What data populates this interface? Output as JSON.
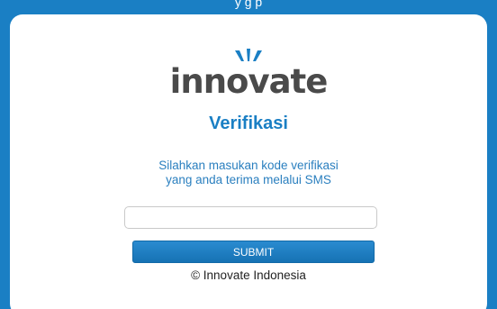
{
  "header": {
    "top_text": "y g p"
  },
  "logo": {
    "text": "innovate",
    "icon": "innovate-sparks-logo",
    "colors": {
      "spark": "#1a7fc4",
      "text": "#4a4a4a"
    }
  },
  "verification": {
    "title": "Verifikasi",
    "instruction_line1": "Silahkan masukan kode verifikasi",
    "instruction_line2": "yang anda terima melalui SMS",
    "code_value": "",
    "code_placeholder": "",
    "submit_label": "SUBMIT"
  },
  "footer": {
    "copyright": "© Innovate Indonesia"
  },
  "colors": {
    "background": "#1a7fc4",
    "card": "#ffffff",
    "accent": "#1a7fc4",
    "button": "#1a7fc4"
  }
}
